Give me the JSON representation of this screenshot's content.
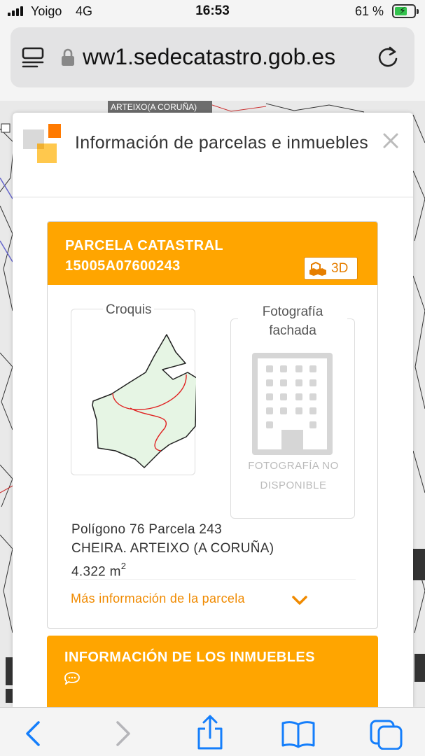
{
  "status_bar": {
    "carrier": "Yoigo",
    "network": "4G",
    "time": "16:53",
    "battery_percent": "61 %",
    "battery_level": 0.61
  },
  "browser": {
    "url": "ww1.sedecatastro.gob.es",
    "reader_icon": "reader-icon",
    "lock_icon": "lock-icon",
    "reload_icon": "reload-icon"
  },
  "map": {
    "label": "ARTEIXO(A CORUÑA)"
  },
  "modal": {
    "title": "Información de parcelas e inmuebles",
    "close_icon": "close-icon"
  },
  "parcel": {
    "heading_line1": "PARCELA CATASTRAL",
    "heading_line2": "15005A07600243",
    "btn_3d": "3D",
    "croquis_label": "Croquis",
    "foto_label": "Fotografía fachada",
    "foto_unavailable": "FOTOGRAFÍA NO DISPONIBLE",
    "location_line1": "Polígono 76 Parcela 243",
    "location_line2": "CHEIRA. ARTEIXO (A CORUÑA)",
    "area_value": "4.322 m",
    "area_unit_exp": "2",
    "more_info": "Más información de la parcela"
  },
  "inmuebles": {
    "title": "INFORMACIÓN DE LOS INMUEBLES"
  },
  "toolbar": {
    "icons": [
      "back-icon",
      "forward-icon",
      "share-icon",
      "bookmarks-icon",
      "tabs-icon"
    ]
  },
  "colors": {
    "accent_orange": "#ffa500",
    "link_orange": "#f08a00",
    "ios_blue": "#147efb"
  }
}
